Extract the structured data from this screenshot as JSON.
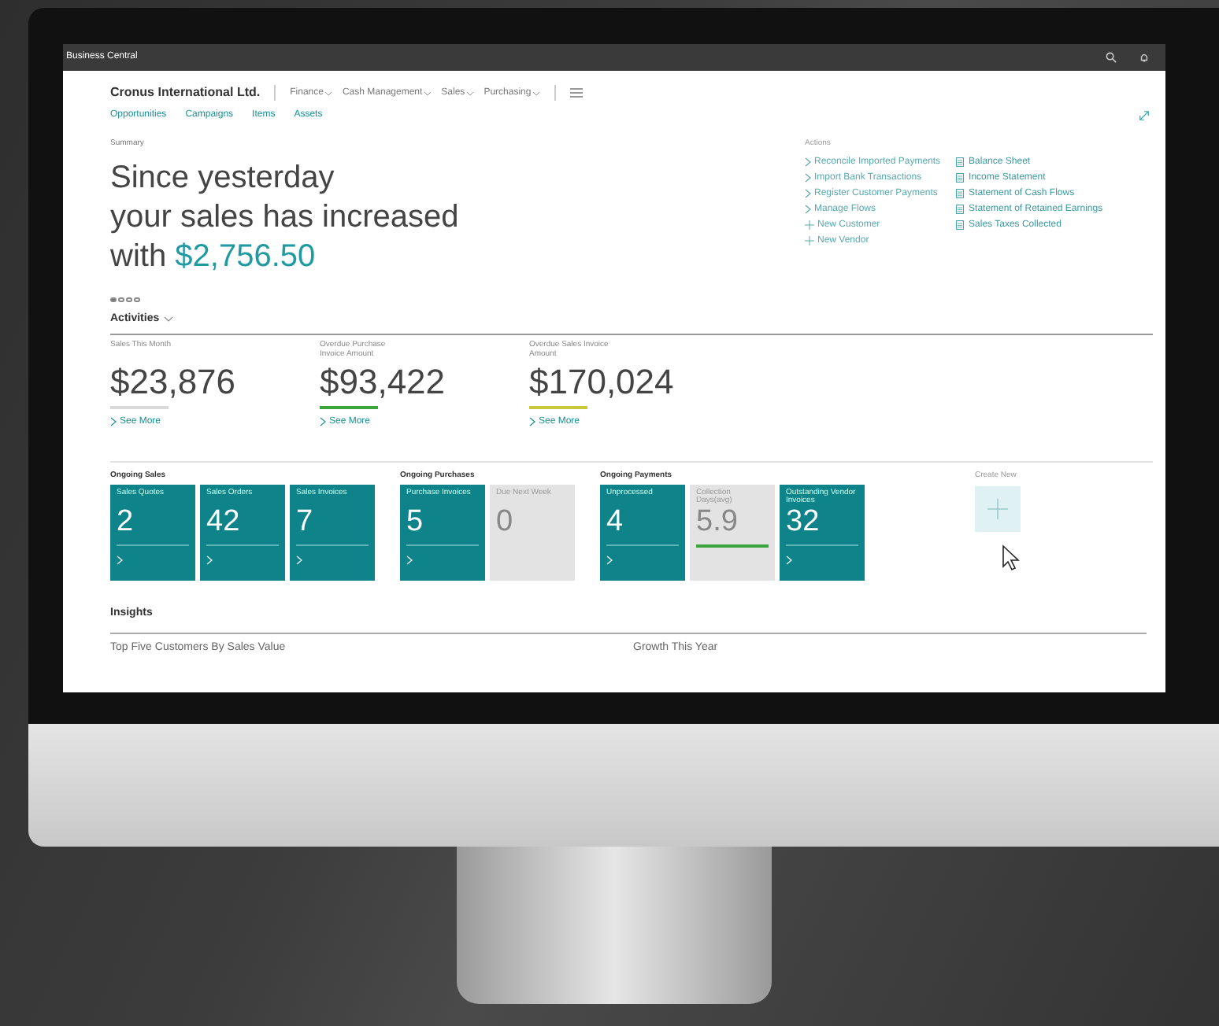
{
  "window": {
    "title": "Business Central"
  },
  "nav": {
    "company": "Cronus International Ltd.",
    "menus": [
      "Finance",
      "Cash Management",
      "Sales",
      "Purchasing"
    ],
    "links": [
      "Opportunities",
      "Campaigns",
      "Items",
      "Assets"
    ]
  },
  "summary": {
    "label": "Summary",
    "lines": [
      "Since yesterday",
      "your sales has increased",
      "with"
    ],
    "amount": "$2,756.50",
    "pager": [
      {
        "selected": true
      },
      {
        "selected": false
      },
      {
        "selected": false
      },
      {
        "selected": false
      }
    ]
  },
  "actions": {
    "label": "Actions",
    "items": [
      {
        "kind": "link",
        "text": "Reconcile Imported Payments"
      },
      {
        "kind": "link",
        "text": "Import Bank Transactions"
      },
      {
        "kind": "link",
        "text": "Register Customer Payments"
      },
      {
        "kind": "link",
        "text": "Manage Flows"
      },
      {
        "kind": "new",
        "text": "New Customer"
      },
      {
        "kind": "new",
        "text": "New Vendor"
      }
    ],
    "reports": [
      "Balance Sheet",
      "Income Statement",
      "Statement of Cash Flows",
      "Statement of Retained Earnings",
      "Sales Taxes Collected"
    ]
  },
  "activities": {
    "title": "Activities",
    "kpis": [
      {
        "label": "Sales This Month",
        "value": "$23,876",
        "link": "See More",
        "color": "#d9d9d9"
      },
      {
        "label": "Overdue Purchase Invoice Amount",
        "value": "$93,422",
        "link": "See More",
        "color": "#3aa53a"
      },
      {
        "label": "Overdue Sales Invoice Amount",
        "value": "$170,024",
        "link": "See More",
        "color": "#c9c83a"
      }
    ]
  },
  "tile_groups": [
    {
      "title": "Ongoing Sales",
      "tiles": [
        {
          "kind": "teal",
          "label": "Sales Quotes",
          "value": "2"
        },
        {
          "kind": "teal",
          "label": "Sales Orders",
          "value": "42"
        },
        {
          "kind": "teal",
          "label": "Sales Invoices",
          "value": "7"
        }
      ]
    },
    {
      "title": "Ongoing Purchases",
      "tiles": [
        {
          "kind": "teal",
          "label": "Purchase Invoices",
          "value": "5"
        },
        {
          "kind": "grey",
          "label": "Due Next Week",
          "value": "0"
        }
      ]
    },
    {
      "title": "Ongoing Payments",
      "tiles": [
        {
          "kind": "teal",
          "label": "Unprocessed",
          "value": "4"
        },
        {
          "kind": "grey",
          "label": "Collection Days(avg)",
          "value": "5.9",
          "color": "#3aa53a"
        },
        {
          "kind": "teal",
          "label": "Outstanding Vendor Invoices",
          "value": "32"
        }
      ]
    }
  ],
  "create_new": {
    "label": "Create New"
  },
  "insights": {
    "title": "Insights",
    "items": [
      "Top Five Customers By Sales Value",
      "Growth This Year"
    ]
  }
}
